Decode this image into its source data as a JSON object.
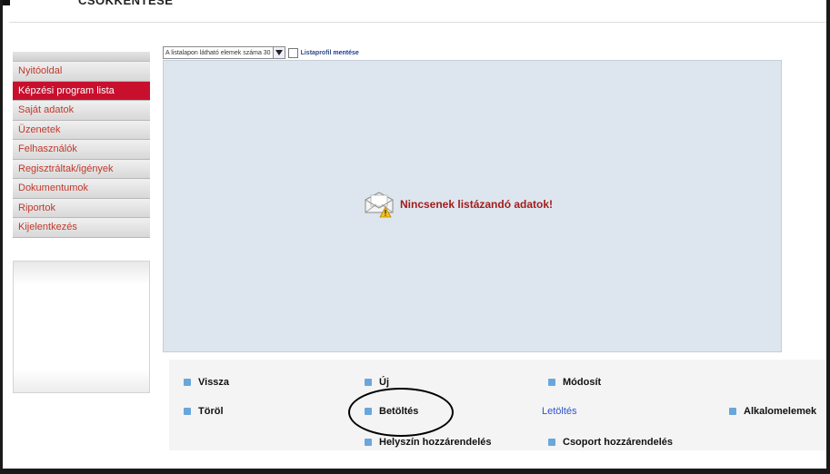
{
  "header": {
    "title": "CSOKKENTESE"
  },
  "sidebar": {
    "items": [
      {
        "label": "Nyitóoldal",
        "active": false
      },
      {
        "label": "Képzési program lista",
        "active": true
      },
      {
        "label": "Saját adatok",
        "active": false
      },
      {
        "label": "Üzenetek",
        "active": false
      },
      {
        "label": "Felhasználók",
        "active": false
      },
      {
        "label": "Regisztráltak/igények",
        "active": false
      },
      {
        "label": "Dokumentumok",
        "active": false
      },
      {
        "label": "Riportok",
        "active": false
      },
      {
        "label": "Kijelentkezés",
        "active": false
      }
    ]
  },
  "listbar": {
    "page_size_label": "A listalapon látható elemek száma 30",
    "profile_label": "Listaprofil",
    "profile_save": "mentése"
  },
  "list": {
    "empty_message": "Nincsenek listázandó adatok!",
    "empty_icon": "envelope-warning-icon"
  },
  "actions": {
    "back": "Vissza",
    "new": "Új",
    "modify": "Módosít",
    "delete": "Töröl",
    "load": "Betöltés",
    "download": "Letöltés",
    "sub_elements": "Alkalomelemek",
    "assign_location": "Helyszín hozzárendelés",
    "assign_group": "Csoport hozzárendelés"
  },
  "colors": {
    "accent_red": "#c8102e",
    "nav_text": "#c0392b",
    "bullet_blue": "#6aa6dc",
    "link_blue": "#2e55c7",
    "panel_bg": "#dde6ee"
  }
}
